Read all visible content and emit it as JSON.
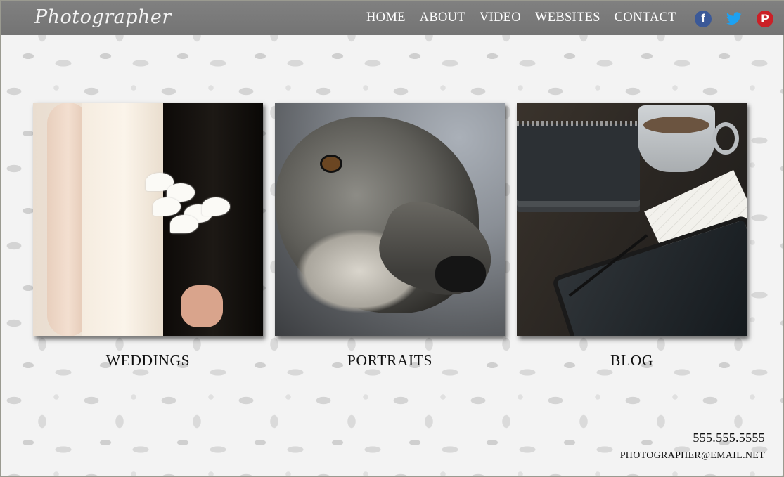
{
  "header": {
    "logo": "Photographer",
    "menu": [
      "HOME",
      "ABOUT",
      "VIDEO",
      "WEBSITES",
      "CONTACT"
    ],
    "social": [
      {
        "icon": "facebook-icon",
        "glyph": "f",
        "color": "#3b5998"
      },
      {
        "icon": "twitter-icon",
        "color": "#1da1f2"
      },
      {
        "icon": "pinterest-icon",
        "glyph": "P",
        "color": "#cb2027"
      }
    ]
  },
  "gallery": [
    {
      "label": "WEDDINGS",
      "image": "bride holding white calla lily bouquet"
    },
    {
      "label": "PORTRAITS",
      "image": "close-up of grey wolf face"
    },
    {
      "label": "BLOG",
      "image": "notebooks, coffee cup and tablet on desk"
    }
  ],
  "footer": {
    "phone": "555.555.5555",
    "email": "PHOTOGRAPHER@EMAIL.NET"
  },
  "colors": {
    "nav_bg": "#7b7b7b",
    "nav_text": "#ffffff",
    "caption_text": "#111111"
  }
}
